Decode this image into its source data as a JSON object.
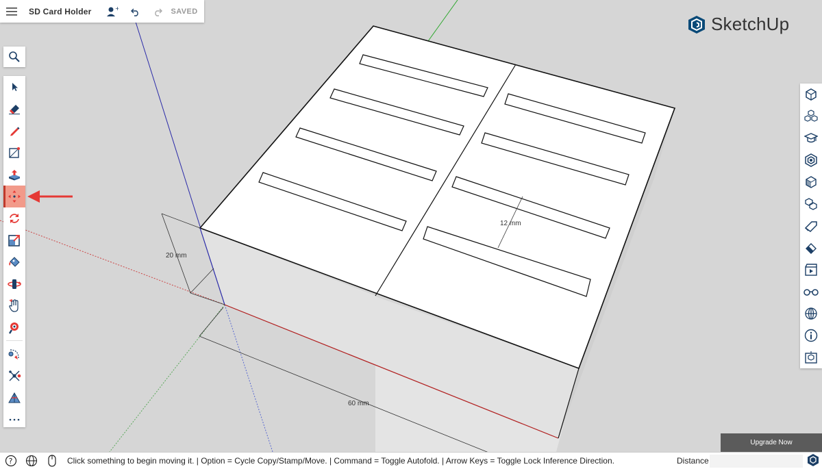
{
  "header": {
    "title": "SD Card Holder",
    "saved_label": "SAVED"
  },
  "brand": {
    "name": "SketchUp",
    "color": "#0a4a78"
  },
  "left_toolbar": {
    "tools": [
      "search-icon",
      "select-icon",
      "eraser-icon",
      "pencil-icon",
      "shapes-icon",
      "push-pull-icon",
      "move-icon",
      "rotate-icon",
      "scale-icon",
      "paint-bucket-icon",
      "orbit-icon",
      "pan-icon",
      "zoom-icon",
      "tape-measure-icon",
      "axes-icon",
      "section-plane-icon",
      "more-icon"
    ],
    "active_tool": "move-icon"
  },
  "right_toolbar": {
    "panels": [
      "entity-info-icon",
      "components-icon",
      "instructor-icon",
      "materials-icon",
      "styles-icon",
      "outliner-icon",
      "tags-icon",
      "eraser-panel-icon",
      "scenes-icon",
      "display-icon",
      "geo-location-icon",
      "info-icon",
      "model-info-icon"
    ]
  },
  "model": {
    "dimensions": {
      "height": "20 mm",
      "length": "60 mm",
      "slot_spacing": "12 mm"
    }
  },
  "upgrade": {
    "label": "Upgrade Now"
  },
  "statusbar": {
    "message": "Click something to begin moving it. | Option = Cycle Copy/Stamp/Move. | Command = Toggle Autofold. | Arrow Keys = Toggle Lock Inference Direction.",
    "measure_label": "Distance",
    "measure_value": ""
  },
  "colors": {
    "background": "#d6d6d6",
    "active_tool": "#f29a8a",
    "accent_red": "#e53935",
    "axis_red": "#b22222",
    "axis_green": "#2ea82e",
    "axis_blue": "#2a2aa8"
  }
}
